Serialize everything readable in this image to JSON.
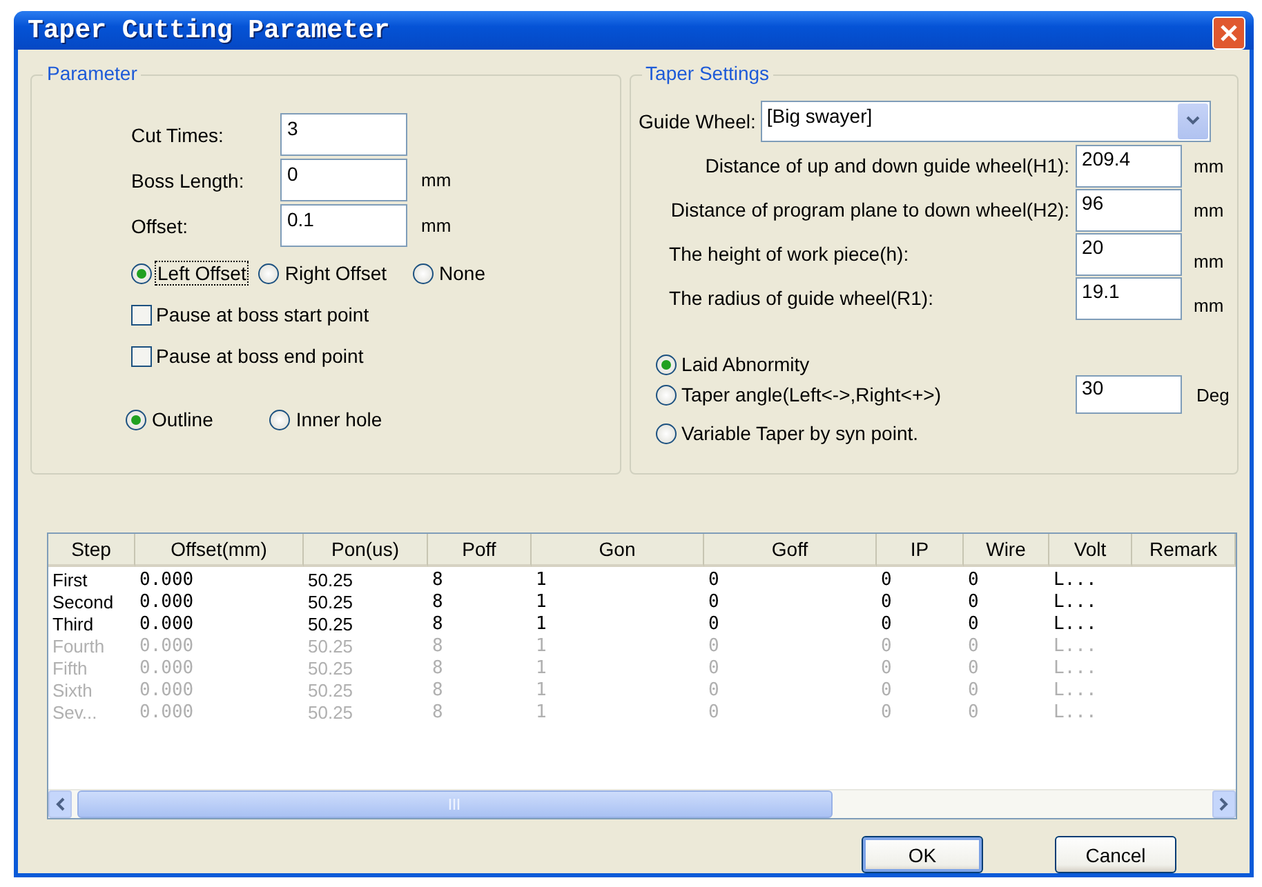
{
  "window": {
    "title": "Taper Cutting Parameter"
  },
  "parameter_group": {
    "title": "Parameter",
    "fields": [
      {
        "label": "Cut Times:",
        "value": "3"
      },
      {
        "label": "Boss Length:",
        "value": "0",
        "unit": "mm"
      },
      {
        "label": "Offset:",
        "value": "0.1",
        "unit": "mm"
      }
    ],
    "offset_options": [
      {
        "label": "Left Offset",
        "selected": true,
        "focused": true
      },
      {
        "label": "Right Offset",
        "selected": false,
        "focused": false
      },
      {
        "label": "None",
        "selected": false,
        "focused": false
      }
    ],
    "checkboxes": [
      {
        "label": "Pause at boss start point",
        "checked": false
      },
      {
        "label": "Pause at boss end point",
        "checked": false
      }
    ],
    "shape_options": [
      {
        "label": "Outline",
        "selected": true
      },
      {
        "label": "Inner hole",
        "selected": false
      }
    ]
  },
  "taper_group": {
    "title": "Taper Settings",
    "guide_wheel": {
      "label": "Guide Wheel:",
      "value": "[Big swayer]"
    },
    "fields": [
      {
        "label": "Distance of up and down guide wheel(H1):",
        "value": "209.4",
        "unit": "mm",
        "kind": "flush"
      },
      {
        "label": "Distance of program plane to down wheel(H2):",
        "value": "96",
        "unit": "mm",
        "kind": "flush"
      },
      {
        "label": "The height of work piece(h):",
        "value": "20",
        "unit": "mm",
        "kind": "indented"
      },
      {
        "label": "The radius of guide wheel(R1):",
        "value": "19.1",
        "unit": "mm",
        "kind": "indented"
      }
    ],
    "modes": [
      {
        "label": "Laid Abnormity",
        "selected": true
      },
      {
        "label": "Taper angle(Left<->,Right<+>)",
        "selected": false,
        "value": "30",
        "unit": "Deg"
      },
      {
        "label": "Variable Taper by syn point.",
        "selected": false
      }
    ]
  },
  "table": {
    "columns": [
      "Step",
      "Offset(mm)",
      "Pon(us)",
      "Poff",
      "Gon",
      "Goff",
      "IP",
      "Wire",
      "Volt",
      "Remark"
    ],
    "rows": [
      {
        "cells": [
          "First",
          "0.000",
          "50.25",
          "8",
          "1",
          "0",
          "0",
          "0",
          "L..."
        ],
        "disabled": false
      },
      {
        "cells": [
          "Second",
          "0.000",
          "50.25",
          "8",
          "1",
          "0",
          "0",
          "0",
          "L..."
        ],
        "disabled": false
      },
      {
        "cells": [
          "Third",
          "0.000",
          "50.25",
          "8",
          "1",
          "0",
          "0",
          "0",
          "L..."
        ],
        "disabled": false
      },
      {
        "cells": [
          "Fourth",
          "0.000",
          "50.25",
          "8",
          "1",
          "0",
          "0",
          "0",
          "L..."
        ],
        "disabled": true
      },
      {
        "cells": [
          "Fifth",
          "0.000",
          "50.25",
          "8",
          "1",
          "0",
          "0",
          "0",
          "L..."
        ],
        "disabled": true
      },
      {
        "cells": [
          "Sixth",
          "0.000",
          "50.25",
          "8",
          "1",
          "0",
          "0",
          "0",
          "L..."
        ],
        "disabled": true
      },
      {
        "cells": [
          "Sev...",
          "0.000",
          "50.25",
          "8",
          "1",
          "0",
          "0",
          "0",
          "L..."
        ],
        "disabled": true
      }
    ]
  },
  "buttons": [
    {
      "label": "OK"
    },
    {
      "label": "Cancel"
    }
  ]
}
